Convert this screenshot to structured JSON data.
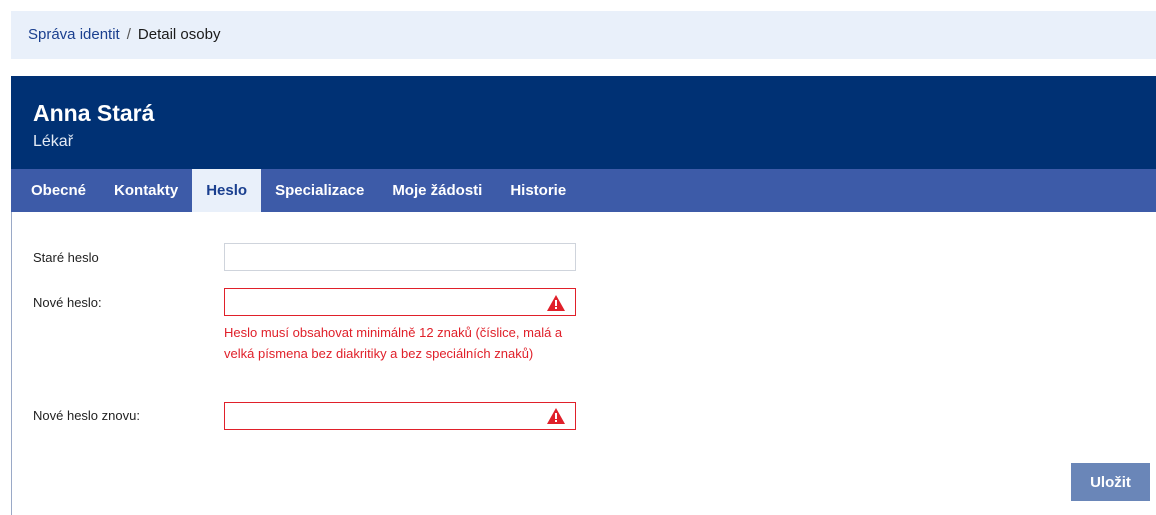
{
  "breadcrumb": {
    "root": "Správa identit",
    "separator": "/",
    "current": "Detail osoby"
  },
  "person": {
    "name": "Anna Stará",
    "role": "Lékař"
  },
  "tabs": [
    {
      "label": "Obecné",
      "active": false
    },
    {
      "label": "Kontakty",
      "active": false
    },
    {
      "label": "Heslo",
      "active": true
    },
    {
      "label": "Specializace",
      "active": false
    },
    {
      "label": "Moje žádosti",
      "active": false
    },
    {
      "label": "Historie",
      "active": false
    }
  ],
  "form": {
    "old_password": {
      "label": "Staré heslo",
      "value": ""
    },
    "new_password": {
      "label": "Nové heslo:",
      "value": "",
      "error_icon": "warning-triangle-icon"
    },
    "error_message": "Heslo musí obsahovat minimálně 12 znaků (číslice, malá a velká písmena bez diakritiky a bez speciálních znaků)",
    "confirm_password": {
      "label": "Nové heslo znovu:",
      "value": "",
      "error_icon": "warning-triangle-icon"
    }
  },
  "actions": {
    "save_label": "Uložit"
  },
  "colors": {
    "header_bg": "#003174",
    "tabs_bg": "#3d5ba8",
    "error": "#e0202a",
    "button_bg": "#6a86b8"
  }
}
